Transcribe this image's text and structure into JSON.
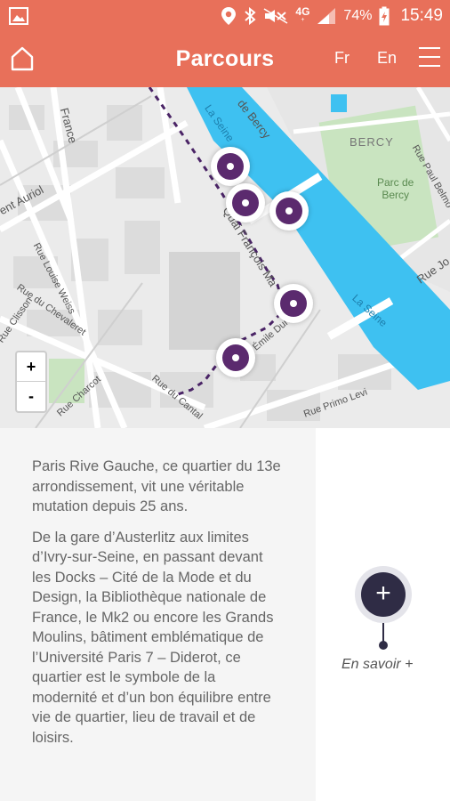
{
  "status_bar": {
    "network": "4G",
    "network_sub": "+",
    "battery": "74%",
    "time": "15:49",
    "icons": [
      "gallery-icon",
      "location-icon",
      "bluetooth-icon",
      "mute-icon",
      "signal-icon",
      "battery-icon"
    ]
  },
  "header": {
    "title": "Parcours",
    "lang_fr": "Fr",
    "lang_en": "En",
    "icons": [
      "home-icon",
      "menu-icon"
    ],
    "background": "#e8705a"
  },
  "map": {
    "labels": {
      "bercy_street": "de Bercy",
      "la_seine_top": "La Seine",
      "bercy": "BERCY",
      "parc_de_bercy": "Parc de\nBercy",
      "rue_paul_belmondo": "Rue Paul Belmo",
      "rue_joseph": "Rue Jo",
      "france": "France",
      "vincent_auriol": "ent Auriol",
      "quai_francois_mauriac": "Quai François Ma",
      "la_seine_bottom": "La Seine",
      "rue_louise_weiss": "Rue Louise Weiss",
      "rue_du_chevaleret": "Rue du Chevaleret",
      "rue_clisson": "Rue Clisson",
      "emile_durkheim": "Émile Durkh",
      "rue_primo_levi": "Rue Primo Levi",
      "rue_charcot": "Rue Charcot",
      "rue_du_cantal": "Rue du Cantal"
    },
    "zoom_in": "+",
    "zoom_out": "-",
    "river_color": "#3ec1f1",
    "marker_color": "#5b2a6e",
    "route_color": "#4a2466"
  },
  "content": {
    "paragraph_1": "Paris Rive Gauche, ce quartier du 13e arrondissement, vit une véritable mutation depuis 25 ans.",
    "paragraph_2": "De la gare d’Austerlitz aux limites d’Ivry-sur-Seine, en passant devant les Docks – Cité de la Mode et du Design, la Bibliothèque nationale de France, le Mk2 ou encore les Grands Moulins, bâtiment emblématique de l’Université Paris 7 – Diderot, ce quartier est le symbole de la modernité et d’un bon équilibre entre vie de quartier, lieu de travail et de loisirs."
  },
  "more": {
    "icon": "plus-icon",
    "symbol": "+",
    "label": "En savoir +"
  }
}
